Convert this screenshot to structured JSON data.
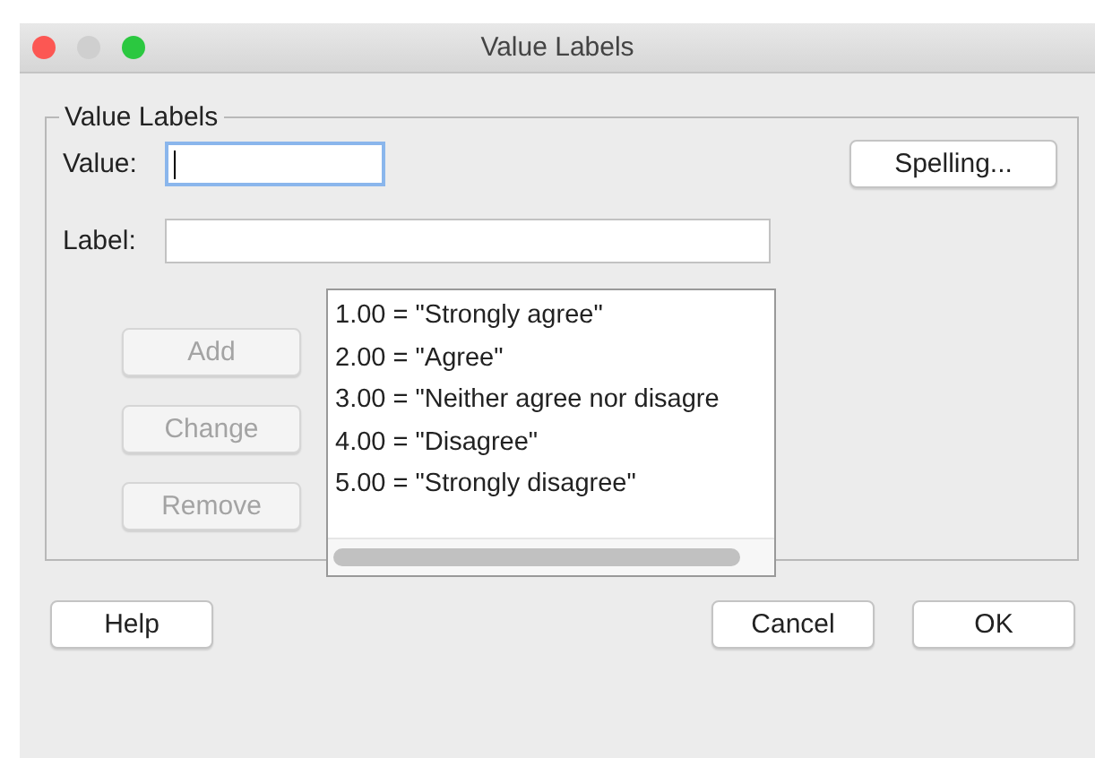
{
  "window": {
    "title": "Value Labels"
  },
  "group": {
    "title": "Value Labels"
  },
  "value_field": {
    "label": "Value:",
    "focused": true
  },
  "label_field": {
    "label": "Label:",
    "focused": false
  },
  "spelling_button": "Spelling...",
  "action_buttons": [
    {
      "label": "Add",
      "disabled": true
    },
    {
      "label": "Change",
      "disabled": true
    },
    {
      "label": "Remove",
      "disabled": true
    }
  ],
  "list": {
    "items": [
      "1.00 = \"Strongly agree\"",
      "2.00 = \"Agree\"",
      "3.00 = \"Neither agree nor disagre",
      "4.00 = \"Disagree\"",
      "5.00 = \"Strongly disagree\""
    ]
  },
  "footer_buttons": [
    "Help",
    "Cancel",
    "OK"
  ]
}
